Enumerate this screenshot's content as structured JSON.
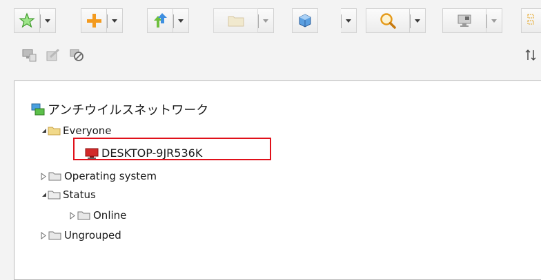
{
  "toolbar": {
    "buttons": [
      {
        "icon": "star-icon"
      },
      {
        "icon": "add-icon"
      },
      {
        "icon": "deploy-arrows-icon"
      },
      {
        "icon": "folder-icon"
      },
      {
        "icon": "package-cube-icon"
      },
      {
        "icon": "search-icon"
      },
      {
        "icon": "computer-scan-icon"
      }
    ],
    "secondary": [
      {
        "icon": "computer-report-icon"
      },
      {
        "icon": "shield-scan-icon"
      },
      {
        "icon": "block-icon"
      }
    ],
    "sort_icon": "sort-icon"
  },
  "tree": {
    "root": {
      "label": "アンチウイルスネットワーク",
      "icon": "network-icon"
    },
    "nodes": [
      {
        "label": "Everyone",
        "expanded": true
      },
      {
        "label": "DESKTOP-9JR536K",
        "type": "computer",
        "status_color": "#d22a2a"
      },
      {
        "label": "Operating system",
        "expanded": false
      },
      {
        "label": "Status",
        "expanded": true
      },
      {
        "label": "Online",
        "expanded": false
      },
      {
        "label": "Ungrouped",
        "expanded": false
      }
    ]
  },
  "colors": {
    "highlight_border": "#e0101a",
    "folder": "#e6c97a"
  }
}
